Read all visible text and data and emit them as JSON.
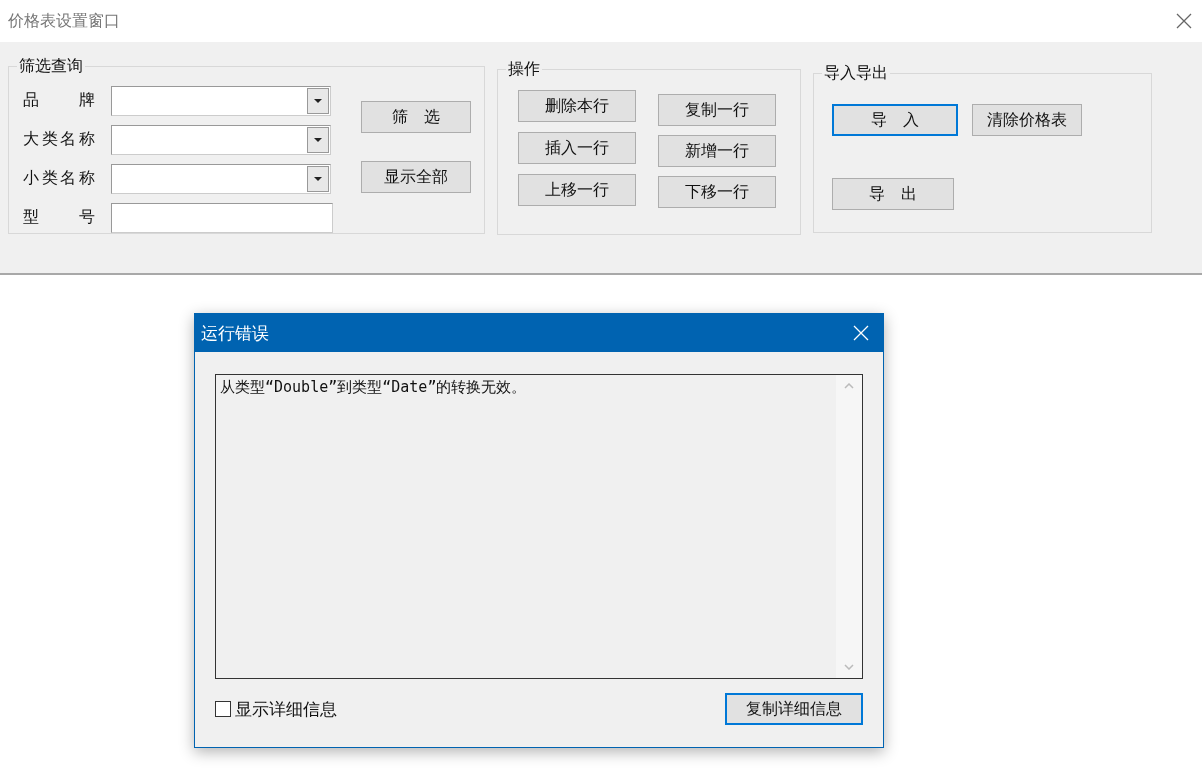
{
  "window": {
    "title": "价格表设置窗口"
  },
  "groups": [
    {
      "kind": "filter",
      "title": "筛选查询",
      "fields": [
        {
          "label": "品 牌",
          "kind": "dropdown"
        },
        {
          "label": "大类名称",
          "kind": "dropdown"
        },
        {
          "label": "小类名称",
          "kind": "dropdown"
        },
        {
          "label": "型 号",
          "kind": "text"
        }
      ],
      "buttons": [
        {
          "label": "筛　选",
          "focused": false
        },
        {
          "label": "显示全部",
          "focused": false
        }
      ]
    },
    {
      "kind": "grid",
      "title": "操作",
      "buttons": [
        {
          "label": "删除本行",
          "focused": false
        },
        {
          "label": "复制一行",
          "focused": false
        },
        {
          "label": "插入一行",
          "focused": false
        },
        {
          "label": "新增一行",
          "focused": false
        },
        {
          "label": "上移一行",
          "focused": false
        },
        {
          "label": "下移一行",
          "focused": false
        }
      ]
    },
    {
      "kind": "io",
      "title": "导入导出",
      "buttons": [
        {
          "label": "导　入",
          "focused": true
        },
        {
          "label": "清除价格表",
          "focused": false
        },
        {
          "label": "导　出",
          "focused": false
        }
      ]
    }
  ],
  "dialog": {
    "title": "运行错误",
    "message": "从类型“Double”到类型“Date”的转换无效。",
    "checkbox": {
      "label": "显示详细信息",
      "checked": false
    },
    "button": {
      "label": "复制详细信息",
      "focused": true
    }
  }
}
